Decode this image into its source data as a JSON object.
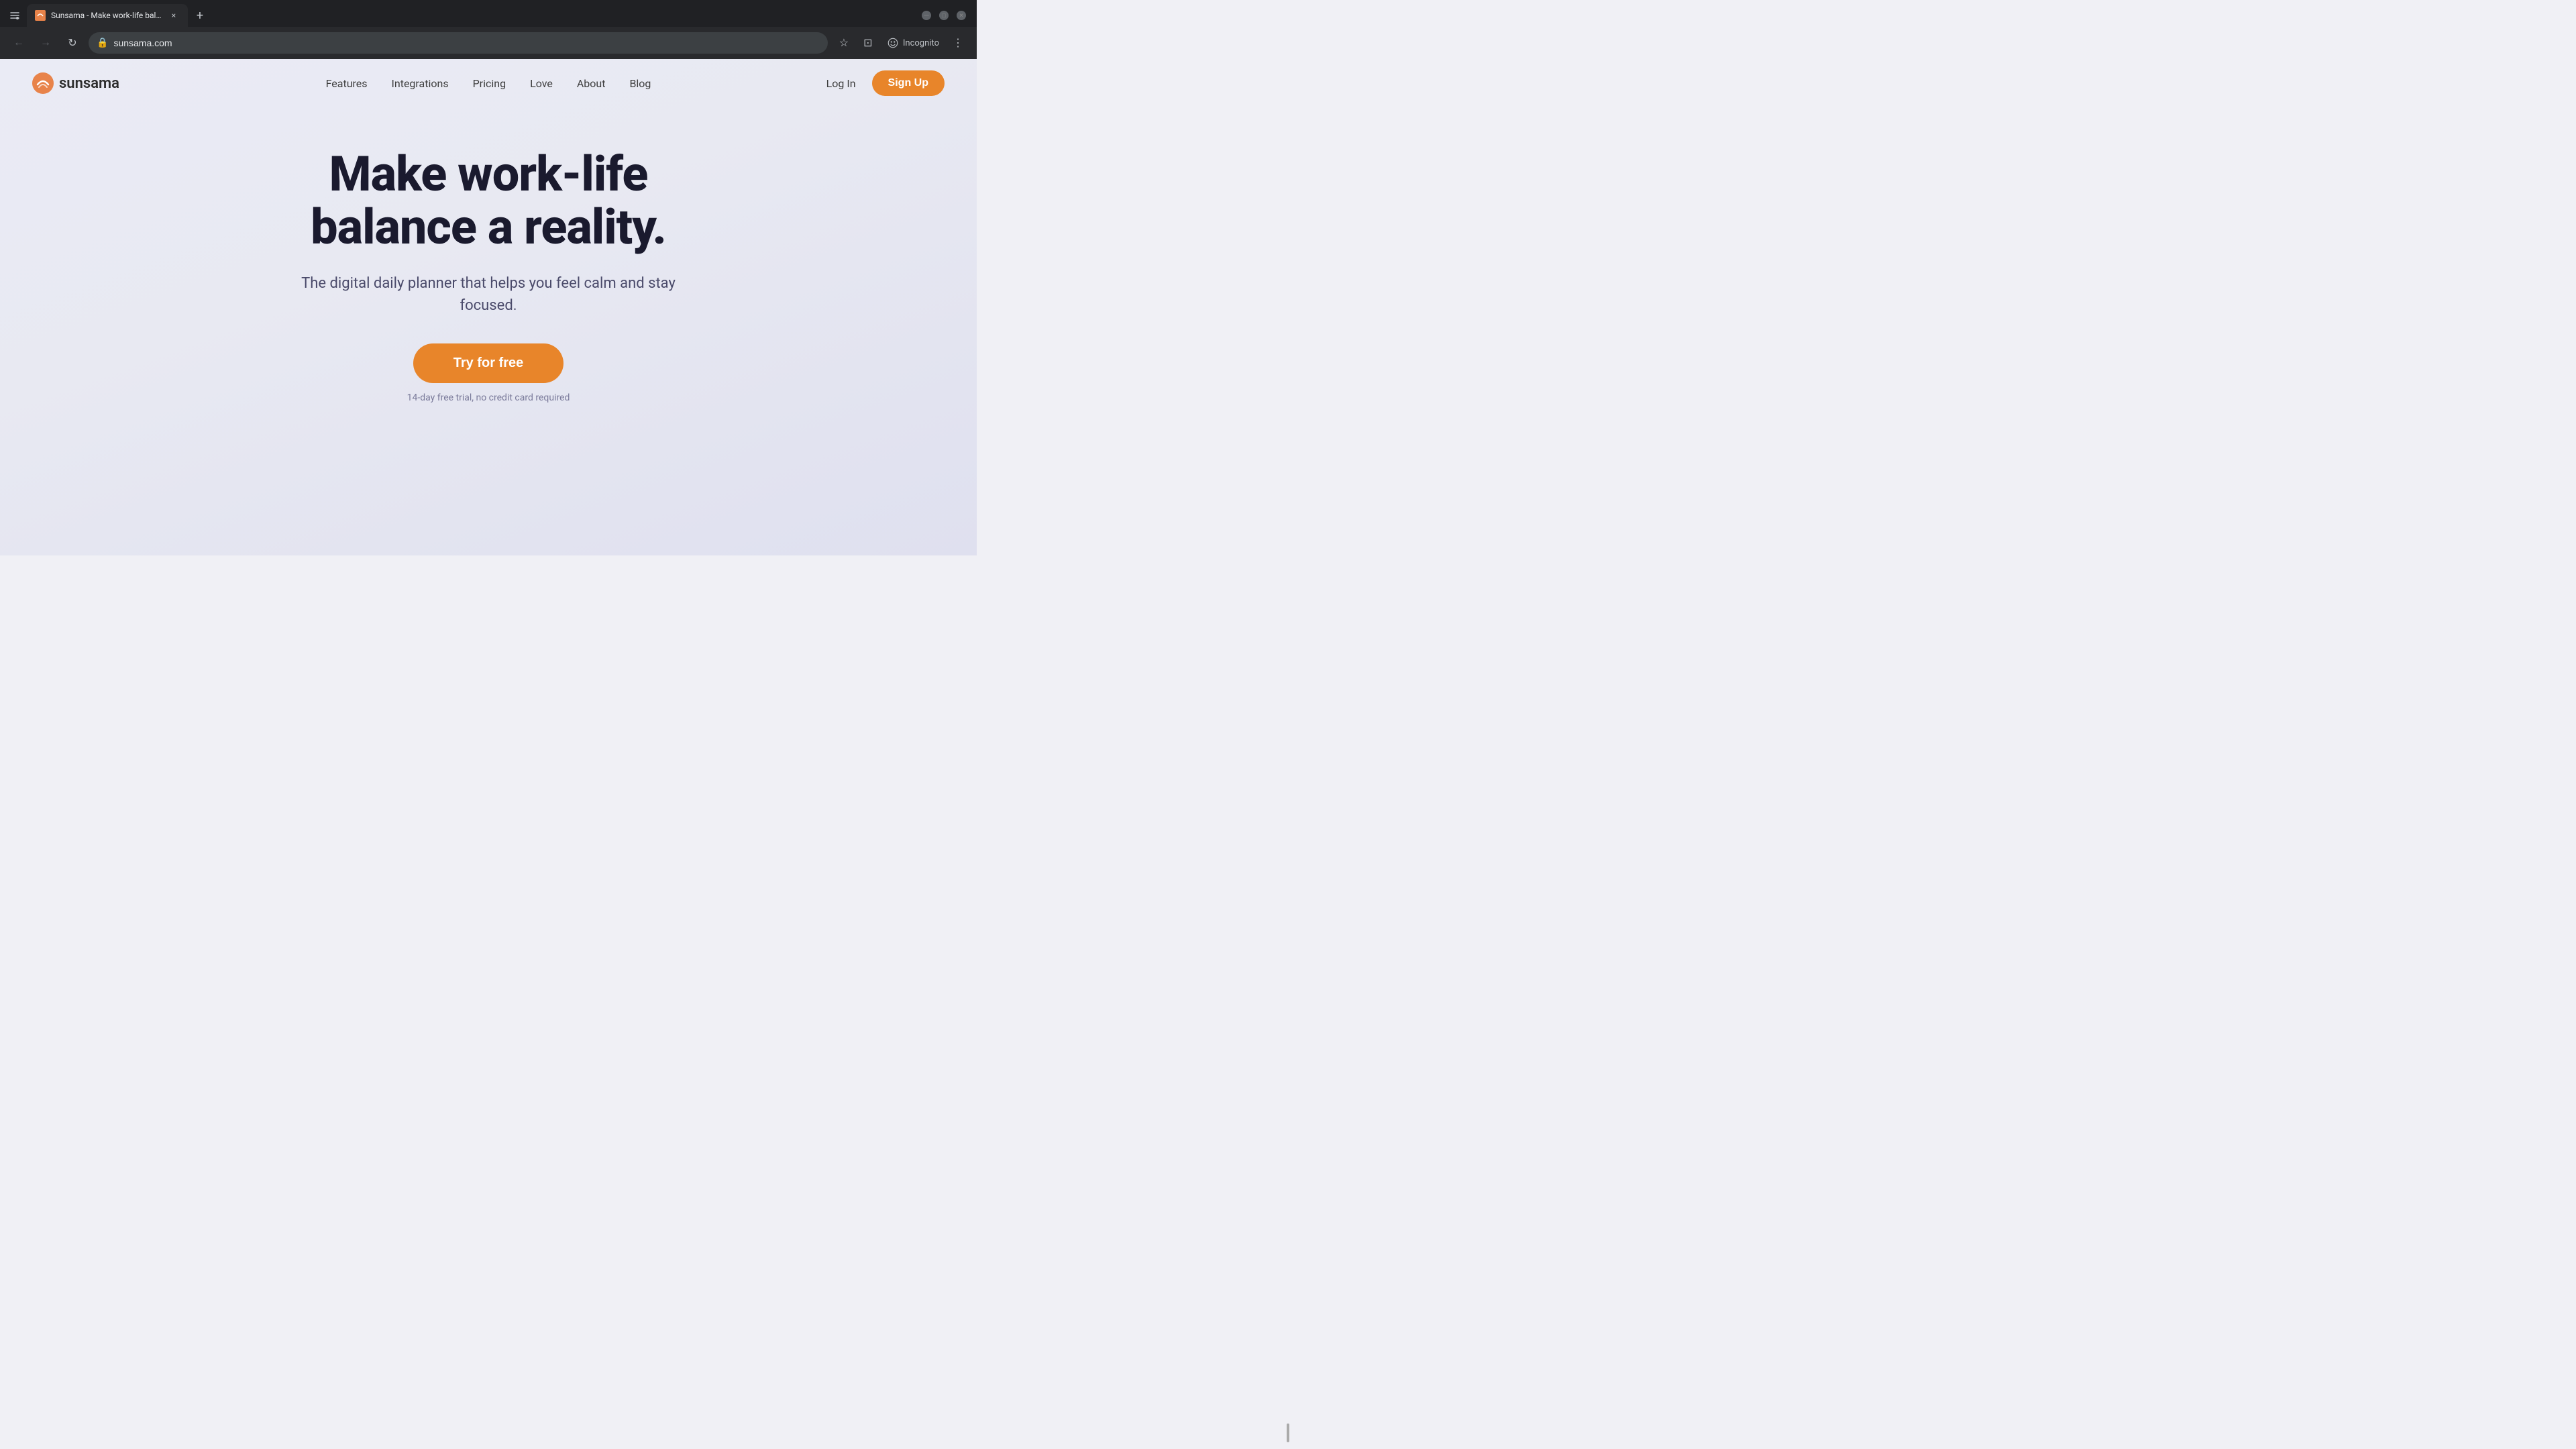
{
  "browser": {
    "tab": {
      "favicon_color": "#e8834a",
      "title": "Sunsama - Make work-life bala...",
      "close_icon": "×",
      "new_tab_icon": "+"
    },
    "toolbar": {
      "back_icon": "←",
      "forward_icon": "→",
      "refresh_icon": "↻",
      "url": "sunsama.com",
      "bookmark_icon": "☆",
      "extensions_icon": "⊡",
      "incognito_label": "Incognito",
      "menu_icon": "⋮"
    }
  },
  "nav": {
    "logo_text": "sunsama",
    "links": [
      {
        "label": "Features",
        "href": "#"
      },
      {
        "label": "Integrations",
        "href": "#"
      },
      {
        "label": "Pricing",
        "href": "#"
      },
      {
        "label": "Love",
        "href": "#"
      },
      {
        "label": "About",
        "href": "#"
      },
      {
        "label": "Blog",
        "href": "#"
      }
    ],
    "login_label": "Log In",
    "signup_label": "Sign Up"
  },
  "hero": {
    "title": "Make work-life balance a reality.",
    "subtitle": "The digital daily planner that helps you feel calm and stay focused.",
    "cta_label": "Try for free",
    "trial_note": "14-day free trial, no credit card required"
  },
  "colors": {
    "accent": "#e8852a",
    "text_dark": "#1a1a2e",
    "text_muted": "#7a7a9a"
  }
}
